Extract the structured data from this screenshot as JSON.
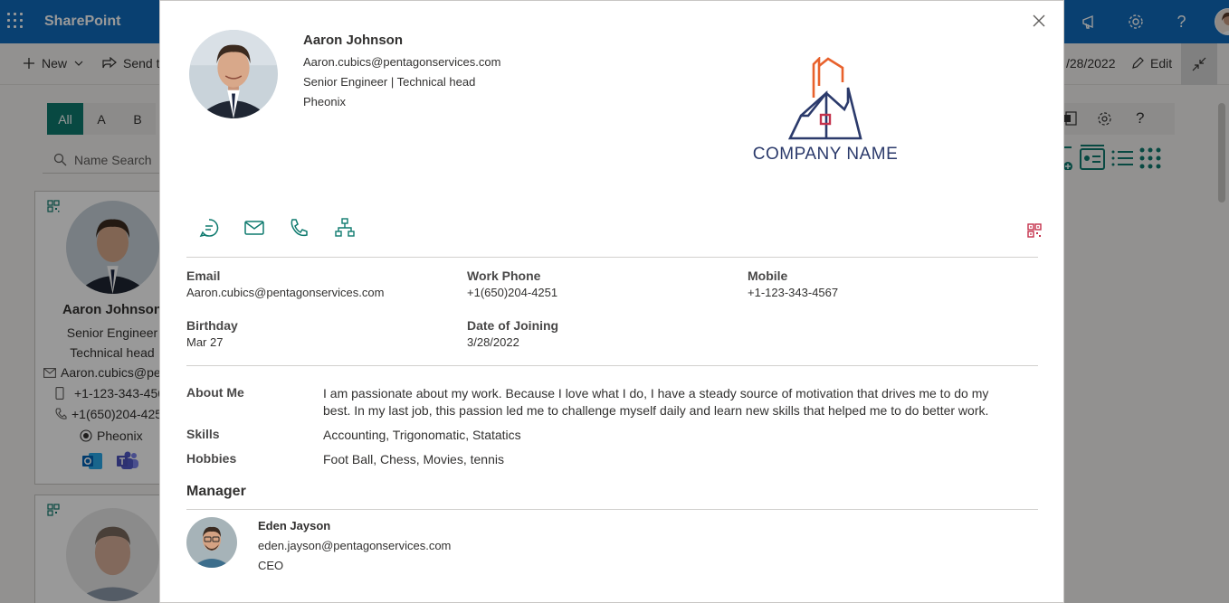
{
  "suite": {
    "brand": "SharePoint",
    "icons": [
      "waffle-icon",
      "megaphone-icon",
      "gear-icon",
      "help-icon",
      "user-avatar"
    ]
  },
  "commands": {
    "new_label": "New",
    "send_label": "Send t",
    "date_label": "/28/2022",
    "edit_label": "Edit"
  },
  "alphabet": [
    "All",
    "A",
    "B"
  ],
  "search": {
    "placeholder": "Name Search"
  },
  "card": {
    "name": "Aaron Johnson",
    "title": "Senior Engineer",
    "role": "Technical head",
    "email": "Aaron.cubics@pe",
    "mobile": "+1-123-343-456",
    "phone": "+1(650)204-425",
    "location": "Pheonix"
  },
  "profile": {
    "name": "Aaron Johnson",
    "email": "Aaron.cubics@pentagonservices.com",
    "title_line": "Senior Engineer | Technical head",
    "location": "Pheonix",
    "company_name": "COMPANY NAME"
  },
  "fields": {
    "email": {
      "label": "Email",
      "value": "Aaron.cubics@pentagonservices.com"
    },
    "work_phone": {
      "label": "Work Phone",
      "value": "+1(650)204-4251"
    },
    "mobile": {
      "label": "Mobile",
      "value": "+1-123-343-4567"
    },
    "birthday": {
      "label": "Birthday",
      "value": "Mar 27"
    },
    "joining": {
      "label": "Date of Joining",
      "value": "3/28/2022"
    }
  },
  "about": {
    "about_label": "About Me",
    "about_line1": "I am passionate about my work. Because I love what I do, I have a steady source of motivation that drives me to do my",
    "about_line2": "best. In my last job, this passion led me to challenge myself daily and learn new skills that helped me to do better work.",
    "skills_label": "Skills",
    "skills_value": "Accounting, Trigonomatic, Statatics",
    "hobbies_label": "Hobbies",
    "hobbies_value": "Foot Ball, Chess, Movies, tennis"
  },
  "manager": {
    "section_title": "Manager",
    "name": "Eden Jayson",
    "email": "eden.jayson@pentagonservices.com",
    "title": "CEO"
  },
  "colors": {
    "suite_blue": "#0f6cbd",
    "accent_teal": "#0e7a6e",
    "qr_red": "#c4314b",
    "logo_navy": "#2b3a6b",
    "logo_orange": "#e8612c"
  }
}
